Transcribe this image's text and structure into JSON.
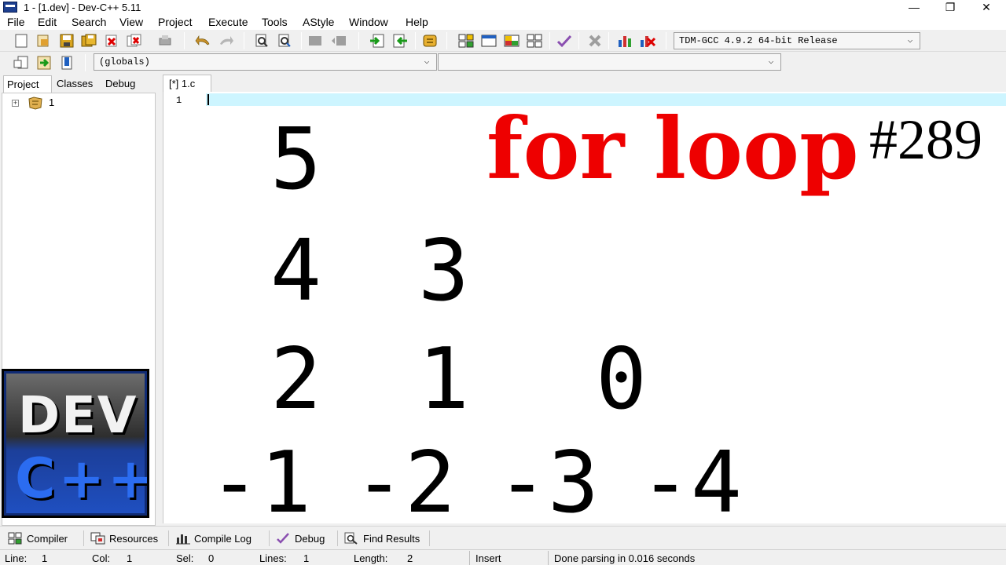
{
  "window": {
    "title": "1 - [1.dev] - Dev-C++ 5.11",
    "minimize_glyph": "—",
    "restore_glyph": "❐",
    "close_glyph": "✕"
  },
  "menu": [
    "File",
    "Edit",
    "Search",
    "View",
    "Project",
    "Execute",
    "Tools",
    "AStyle",
    "Window",
    "Help"
  ],
  "toolbar": {
    "compiler_select": "TDM-GCC 4.9.2 64-bit Release",
    "scope_select": "(globals)",
    "function_select": ""
  },
  "left_panel": {
    "tabs": [
      "Project",
      "Classes",
      "Debug"
    ],
    "active_tab": "Project",
    "tree_root_label": "1",
    "tree_expand_glyph": "+",
    "logo_line1": "DEV",
    "logo_line2": "C++"
  },
  "editor": {
    "tab_label": "[*] 1.c",
    "line_number": "1"
  },
  "overlay": {
    "title": "for loop",
    "episode": "#289",
    "title_color": "#ee0000",
    "numbers": {
      "r1c1": "5",
      "r2c1": "4",
      "r2c2": "3",
      "r3c1": "2",
      "r3c2": "1",
      "r3c3": "0",
      "r4c1": "-1",
      "r4c2": "-2",
      "r4c3": "-3",
      "r4c4": "-4"
    }
  },
  "bottom_tabs": [
    {
      "label": "Compiler",
      "icon": "compiler-grid-icon"
    },
    {
      "label": "Resources",
      "icon": "resources-icon"
    },
    {
      "label": "Compile Log",
      "icon": "compile-log-chart-icon"
    },
    {
      "label": "Debug",
      "icon": "debug-check-icon"
    },
    {
      "label": "Find Results",
      "icon": "find-results-icon"
    }
  ],
  "status": {
    "line_label": "Line:",
    "line_value": "1",
    "col_label": "Col:",
    "col_value": "1",
    "sel_label": "Sel:",
    "sel_value": "0",
    "lines_label": "Lines:",
    "lines_value": "1",
    "length_label": "Length:",
    "length_value": "2",
    "mode": "Insert",
    "message": "Done parsing in 0.016 seconds"
  }
}
